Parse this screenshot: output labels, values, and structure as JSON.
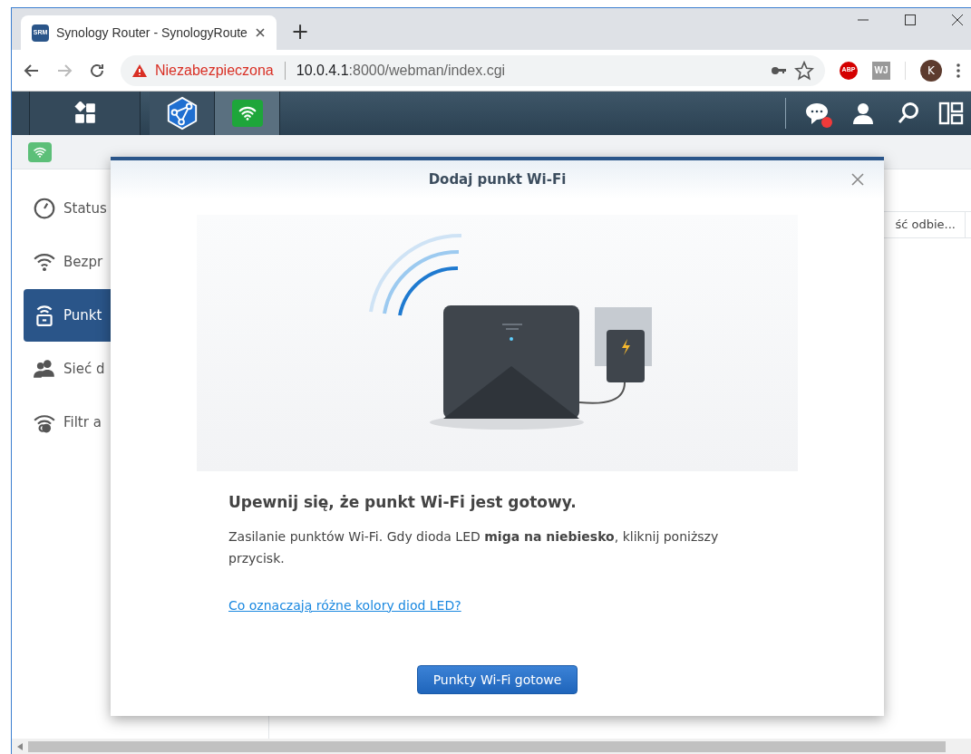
{
  "browser": {
    "tab": {
      "title": "Synology Router - SynologyRoute",
      "favicon": "SRM"
    },
    "new_tab": "+",
    "security": "Niezabezpieczona",
    "url_host": "10.0.4.1",
    "url_rest": ":8000/webman/index.cgi",
    "avatar": "K",
    "extensions": [
      {
        "kind": "abp",
        "label": "ABP"
      },
      {
        "kind": "wj",
        "label": "WJ"
      }
    ]
  },
  "taskbar": {
    "apps": [
      {
        "kind": "grid",
        "selected": false
      },
      {
        "kind": "network",
        "selected": false
      },
      {
        "kind": "wifi",
        "selected": true
      }
    ],
    "notification": true
  },
  "sidebar": {
    "items": [
      {
        "kind": "gauge",
        "label": "Status",
        "selected": false
      },
      {
        "kind": "wifi",
        "label": "Bezpr",
        "selected": false
      },
      {
        "kind": "point",
        "label": "Punkt",
        "selected": true
      },
      {
        "kind": "people",
        "label": "Sieć d",
        "selected": false
      },
      {
        "kind": "filter",
        "label": "Filtr a",
        "selected": false
      }
    ]
  },
  "table": {
    "column_1": "ść odbie..."
  },
  "dialog": {
    "title": "Dodaj punkt Wi-Fi",
    "heading": "Upewnij się, że punkt Wi-Fi jest gotowy.",
    "text": "Zasilanie punktów Wi-Fi. Gdy dioda LED **miga na niebiesko**, kliknij poniższy przycisk.",
    "link": "Co oznaczają różne kolory diod LED?",
    "button": "Punkty Wi-Fi gotowe"
  }
}
